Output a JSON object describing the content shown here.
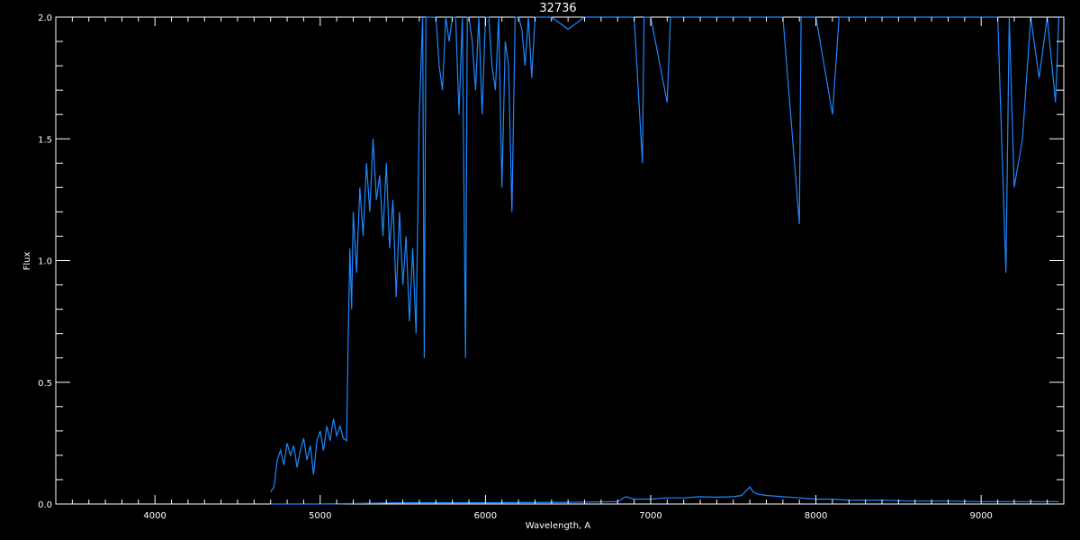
{
  "chart_data": {
    "type": "line",
    "title": "32736",
    "xlabel": "Wavelength, A",
    "ylabel": "Flux",
    "xlim": [
      3400,
      9500
    ],
    "ylim": [
      0.0,
      2.0
    ],
    "xticks": [
      4000,
      5000,
      6000,
      7000,
      8000,
      9000
    ],
    "xtick_labels": [
      "4000",
      "5000",
      "6000",
      "7000",
      "8000",
      "9000"
    ],
    "yticks": [
      0.0,
      0.5,
      1.0,
      1.5,
      2.0
    ],
    "ytick_labels": [
      "0.0",
      "0.5",
      "1.0",
      "1.5",
      "2.0"
    ],
    "grid": false,
    "background": "#000000",
    "axis_color": "#ffffff",
    "series": [
      {
        "color": "#1e87ff",
        "x": [
          4700,
          4720,
          4740,
          4760,
          4780,
          4800,
          4820,
          4840,
          4860,
          4880,
          4900,
          4920,
          4940,
          4960,
          4980,
          5000,
          5020,
          5040,
          5060,
          5080,
          5100,
          5120,
          5140,
          5160,
          5170,
          5180,
          5190,
          5200,
          5220,
          5240,
          5260,
          5280,
          5300,
          5320,
          5340,
          5360,
          5380,
          5400,
          5420,
          5440,
          5460,
          5480,
          5500,
          5520,
          5540,
          5560,
          5580,
          5600,
          5620,
          5630,
          5640,
          5660,
          5680,
          5700,
          5720,
          5740,
          5760,
          5780,
          5800,
          5820,
          5840,
          5860,
          5880,
          5890,
          5900,
          5920,
          5940,
          5960,
          5980,
          6000,
          6020,
          6040,
          6060,
          6080,
          6100,
          6120,
          6140,
          6160,
          6180,
          6200,
          6220,
          6240,
          6260,
          6280,
          6300,
          6400,
          6500,
          6600,
          6700,
          6800,
          6900,
          6950,
          6960,
          7000,
          7100,
          7120,
          7200,
          7300,
          7400,
          7500,
          7600,
          7700,
          7800,
          7900,
          7910,
          7920,
          8000,
          8100,
          8140,
          8200,
          8300,
          8400,
          8500,
          8600,
          8700,
          8800,
          8900,
          9000,
          9100,
          9150,
          9170,
          9200,
          9250,
          9300,
          9350,
          9400,
          9450,
          9470
        ],
        "y": [
          0.05,
          0.07,
          0.18,
          0.22,
          0.16,
          0.25,
          0.2,
          0.24,
          0.15,
          0.22,
          0.27,
          0.18,
          0.24,
          0.12,
          0.26,
          0.3,
          0.22,
          0.32,
          0.26,
          0.35,
          0.28,
          0.32,
          0.27,
          0.26,
          0.7,
          1.05,
          0.8,
          1.2,
          0.95,
          1.3,
          1.1,
          1.4,
          1.2,
          1.5,
          1.25,
          1.35,
          1.1,
          1.4,
          1.05,
          1.25,
          0.85,
          1.2,
          0.9,
          1.1,
          0.75,
          1.05,
          0.7,
          1.6,
          2.0,
          0.6,
          2.0,
          2.0,
          2.0,
          2.0,
          1.8,
          1.7,
          2.0,
          1.9,
          2.0,
          2.0,
          1.6,
          2.0,
          0.6,
          2.0,
          2.0,
          1.9,
          1.7,
          2.0,
          1.6,
          2.0,
          2.0,
          1.8,
          1.7,
          2.0,
          1.3,
          1.9,
          1.8,
          1.2,
          2.0,
          2.0,
          1.95,
          1.8,
          2.0,
          1.75,
          2.0,
          2.0,
          1.95,
          2.0,
          2.0,
          2.0,
          2.0,
          1.4,
          2.0,
          2.0,
          1.65,
          2.0,
          2.0,
          2.0,
          2.0,
          2.0,
          2.0,
          2.0,
          2.0,
          1.15,
          2.0,
          2.0,
          2.0,
          1.6,
          2.0,
          2.0,
          2.0,
          2.0,
          2.0,
          2.0,
          2.0,
          2.0,
          2.0,
          2.0,
          2.0,
          0.95,
          2.0,
          1.3,
          1.5,
          2.0,
          1.75,
          2.0,
          1.65,
          2.0
        ]
      },
      {
        "color": "#1e87ff",
        "x": [
          4700,
          5000,
          5500,
          6000,
          6500,
          6800,
          6850,
          6900,
          6950,
          7000,
          7100,
          7200,
          7300,
          7400,
          7500,
          7550,
          7600,
          7620,
          7650,
          7700,
          7800,
          7900,
          8000,
          8100,
          8200,
          8400,
          8600,
          8800,
          9000,
          9200,
          9470
        ],
        "y": [
          0.0,
          0.0,
          0.005,
          0.005,
          0.007,
          0.01,
          0.03,
          0.02,
          0.02,
          0.02,
          0.025,
          0.025,
          0.03,
          0.028,
          0.03,
          0.035,
          0.07,
          0.05,
          0.04,
          0.035,
          0.03,
          0.025,
          0.02,
          0.02,
          0.015,
          0.015,
          0.012,
          0.012,
          0.01,
          0.01,
          0.01
        ]
      }
    ]
  }
}
